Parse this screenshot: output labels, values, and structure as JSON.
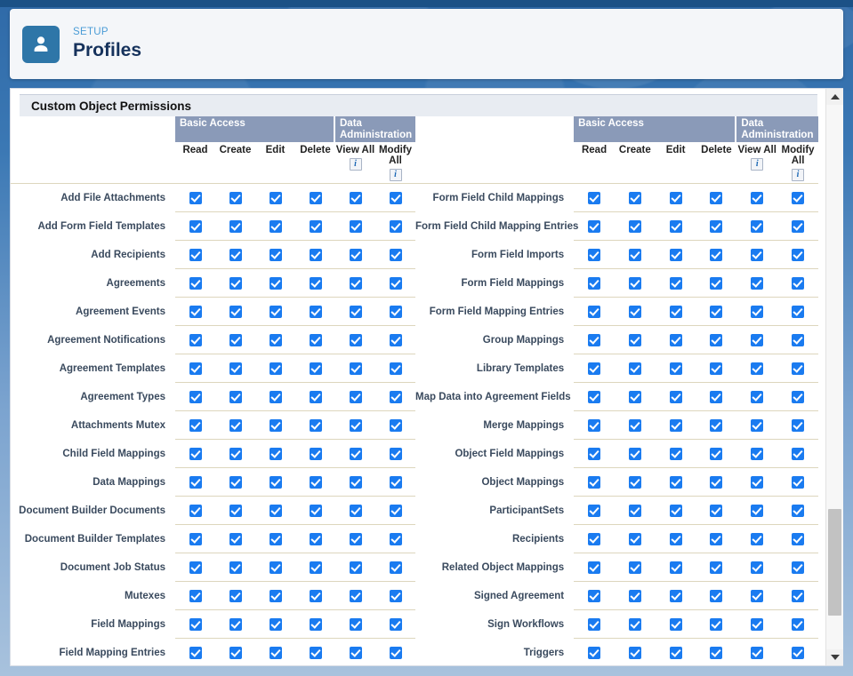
{
  "header": {
    "breadcrumb": "SETUP",
    "title": "Profiles",
    "avatar_icon": "person-icon"
  },
  "section": {
    "title": "Custom Object Permissions"
  },
  "columns": {
    "groups": [
      {
        "label": "Basic Access",
        "span": 4
      },
      {
        "label": "Data Administration",
        "span": 2
      }
    ],
    "sub": [
      {
        "label": "Read",
        "info": false
      },
      {
        "label": "Create",
        "info": false
      },
      {
        "label": "Edit",
        "info": false
      },
      {
        "label": "Delete",
        "info": false
      },
      {
        "label": "View All",
        "info": true
      },
      {
        "label": "Modify All",
        "info": true
      }
    ],
    "info_glyph": "i"
  },
  "colors": {
    "group_header_bg": "#8a9ab8",
    "checkbox_blue": "#1a7bf0",
    "section_bar_bg": "#e8ecf2",
    "row_divider": "#ddd6bd",
    "accent_link": "#4a9cd6",
    "avatar_bg": "#2e76a8",
    "page_bg": "#1e5a96"
  },
  "left_rows": [
    {
      "label": "Add File Attachments",
      "checks": [
        true,
        true,
        true,
        true,
        true,
        true
      ]
    },
    {
      "label": "Add Form Field Templates",
      "checks": [
        true,
        true,
        true,
        true,
        true,
        true
      ]
    },
    {
      "label": "Add Recipients",
      "checks": [
        true,
        true,
        true,
        true,
        true,
        true
      ]
    },
    {
      "label": "Agreements",
      "checks": [
        true,
        true,
        true,
        true,
        true,
        true
      ]
    },
    {
      "label": "Agreement Events",
      "checks": [
        true,
        true,
        true,
        true,
        true,
        true
      ]
    },
    {
      "label": "Agreement Notifications",
      "checks": [
        true,
        true,
        true,
        true,
        true,
        true
      ]
    },
    {
      "label": "Agreement Templates",
      "checks": [
        true,
        true,
        true,
        true,
        true,
        true
      ]
    },
    {
      "label": "Agreement Types",
      "checks": [
        true,
        true,
        true,
        true,
        true,
        true
      ]
    },
    {
      "label": "Attachments Mutex",
      "checks": [
        true,
        true,
        true,
        true,
        true,
        true
      ]
    },
    {
      "label": "Child Field Mappings",
      "checks": [
        true,
        true,
        true,
        true,
        true,
        true
      ]
    },
    {
      "label": "Data Mappings",
      "checks": [
        true,
        true,
        true,
        true,
        true,
        true
      ]
    },
    {
      "label": "Document Builder Documents",
      "checks": [
        true,
        true,
        true,
        true,
        true,
        true
      ]
    },
    {
      "label": "Document Builder Templates",
      "checks": [
        true,
        true,
        true,
        true,
        true,
        true
      ]
    },
    {
      "label": "Document Job Status",
      "checks": [
        true,
        true,
        true,
        true,
        true,
        true
      ]
    },
    {
      "label": "Mutexes",
      "checks": [
        true,
        true,
        true,
        true,
        true,
        true
      ]
    },
    {
      "label": "Field Mappings",
      "checks": [
        true,
        true,
        true,
        true,
        true,
        true
      ]
    },
    {
      "label": "Field Mapping Entries",
      "checks": [
        true,
        true,
        true,
        true,
        true,
        true
      ]
    }
  ],
  "right_rows": [
    {
      "label": "Form Field Child Mappings",
      "checks": [
        true,
        true,
        true,
        true,
        true,
        true
      ]
    },
    {
      "label": "Form Field Child Mapping Entries",
      "checks": [
        true,
        true,
        true,
        true,
        true,
        true
      ]
    },
    {
      "label": "Form Field Imports",
      "checks": [
        true,
        true,
        true,
        true,
        true,
        true
      ]
    },
    {
      "label": "Form Field Mappings",
      "checks": [
        true,
        true,
        true,
        true,
        true,
        true
      ]
    },
    {
      "label": "Form Field Mapping Entries",
      "checks": [
        true,
        true,
        true,
        true,
        true,
        true
      ]
    },
    {
      "label": "Group Mappings",
      "checks": [
        true,
        true,
        true,
        true,
        true,
        true
      ]
    },
    {
      "label": "Library Templates",
      "checks": [
        true,
        true,
        true,
        true,
        true,
        true
      ]
    },
    {
      "label": "Map Data into Agreement Fields",
      "checks": [
        true,
        true,
        true,
        true,
        true,
        true
      ]
    },
    {
      "label": "Merge Mappings",
      "checks": [
        true,
        true,
        true,
        true,
        true,
        true
      ]
    },
    {
      "label": "Object Field Mappings",
      "checks": [
        true,
        true,
        true,
        true,
        true,
        true
      ]
    },
    {
      "label": "Object Mappings",
      "checks": [
        true,
        true,
        true,
        true,
        true,
        true
      ]
    },
    {
      "label": "ParticipantSets",
      "checks": [
        true,
        true,
        true,
        true,
        true,
        true
      ]
    },
    {
      "label": "Recipients",
      "checks": [
        true,
        true,
        true,
        true,
        true,
        true
      ]
    },
    {
      "label": "Related Object Mappings",
      "checks": [
        true,
        true,
        true,
        true,
        true,
        true
      ]
    },
    {
      "label": "Signed Agreement",
      "checks": [
        true,
        true,
        true,
        true,
        true,
        true
      ]
    },
    {
      "label": "Sign Workflows",
      "checks": [
        true,
        true,
        true,
        true,
        true,
        true
      ]
    },
    {
      "label": "Triggers",
      "checks": [
        true,
        true,
        true,
        true,
        true,
        true
      ]
    }
  ],
  "scrollbar": {
    "up_arrow": "caret-up-icon",
    "down_arrow": "caret-down-icon"
  }
}
